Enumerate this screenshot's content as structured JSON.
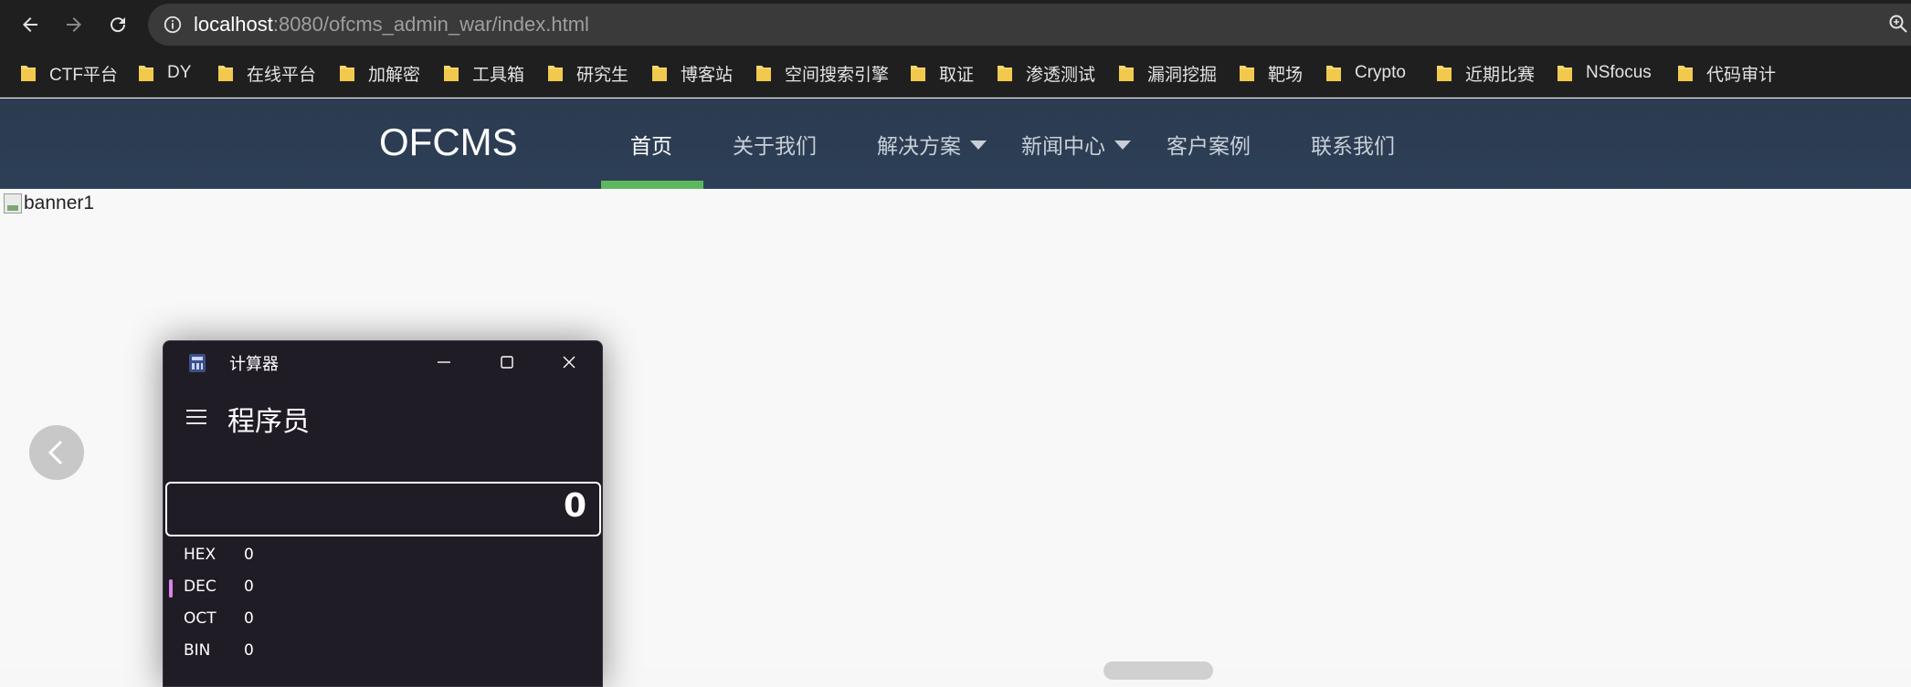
{
  "browser": {
    "url_host": "localhost",
    "url_rest": ":8080/ofcms_admin_war/index.html",
    "bookmarks": [
      {
        "label": "CTF平台"
      },
      {
        "label": "DY"
      },
      {
        "label": "在线平台"
      },
      {
        "label": "加解密"
      },
      {
        "label": "工具箱"
      },
      {
        "label": "研究生"
      },
      {
        "label": "博客站"
      },
      {
        "label": "空间搜索引擎"
      },
      {
        "label": "取证"
      },
      {
        "label": "渗透测试"
      },
      {
        "label": "漏洞挖掘"
      },
      {
        "label": "靶场"
      },
      {
        "label": "Crypto"
      },
      {
        "label": "近期比赛"
      },
      {
        "label": "NSfocus"
      },
      {
        "label": "代码审计"
      }
    ]
  },
  "site": {
    "logo": "OFCMS",
    "nav": [
      {
        "label": "首页",
        "active": true
      },
      {
        "label": "关于我们"
      },
      {
        "label": "解决方案",
        "dropdown": true
      },
      {
        "label": "新闻中心",
        "dropdown": true
      },
      {
        "label": "客户案例"
      },
      {
        "label": "联系我们"
      }
    ],
    "accent_color": "#5cb85c",
    "banner_alt": "banner1"
  },
  "calculator": {
    "title": "计算器",
    "mode": "程序员",
    "display": "0",
    "radix": [
      {
        "label": "HEX",
        "value": "0"
      },
      {
        "label": "DEC",
        "value": "0",
        "selected": true
      },
      {
        "label": "OCT",
        "value": "0"
      },
      {
        "label": "BIN",
        "value": "0"
      }
    ]
  }
}
